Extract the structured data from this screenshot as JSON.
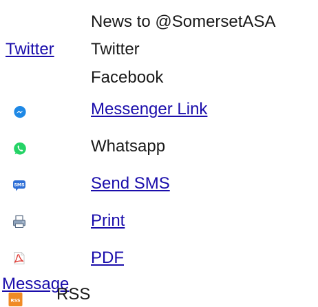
{
  "share": {
    "news_to": "News to @SomersetASA",
    "twitter_link": "Twitter",
    "twitter_text": "Twitter",
    "facebook_text": "Facebook",
    "messenger_link": "Messenger Link",
    "whatsapp_text": "Whatsapp",
    "sms_link": "Send SMS",
    "sms_icon_text": "SMS",
    "print_link": "Print",
    "pdf_link": "PDF",
    "message_link": "Message",
    "rss_text": "RSS",
    "rss_icon_text": "RSS"
  },
  "icons": {
    "messenger": "messenger-icon",
    "whatsapp": "whatsapp-icon",
    "sms": "sms-icon",
    "print": "printer-icon",
    "pdf": "pdf-icon",
    "rss": "rss-icon"
  },
  "colors": {
    "link": "#1a0dab",
    "messenger": "#1e88e5",
    "whatsapp": "#25d366",
    "sms": "#2f6fd6",
    "pdf": "#e0403a",
    "rss": "#f08a24"
  }
}
